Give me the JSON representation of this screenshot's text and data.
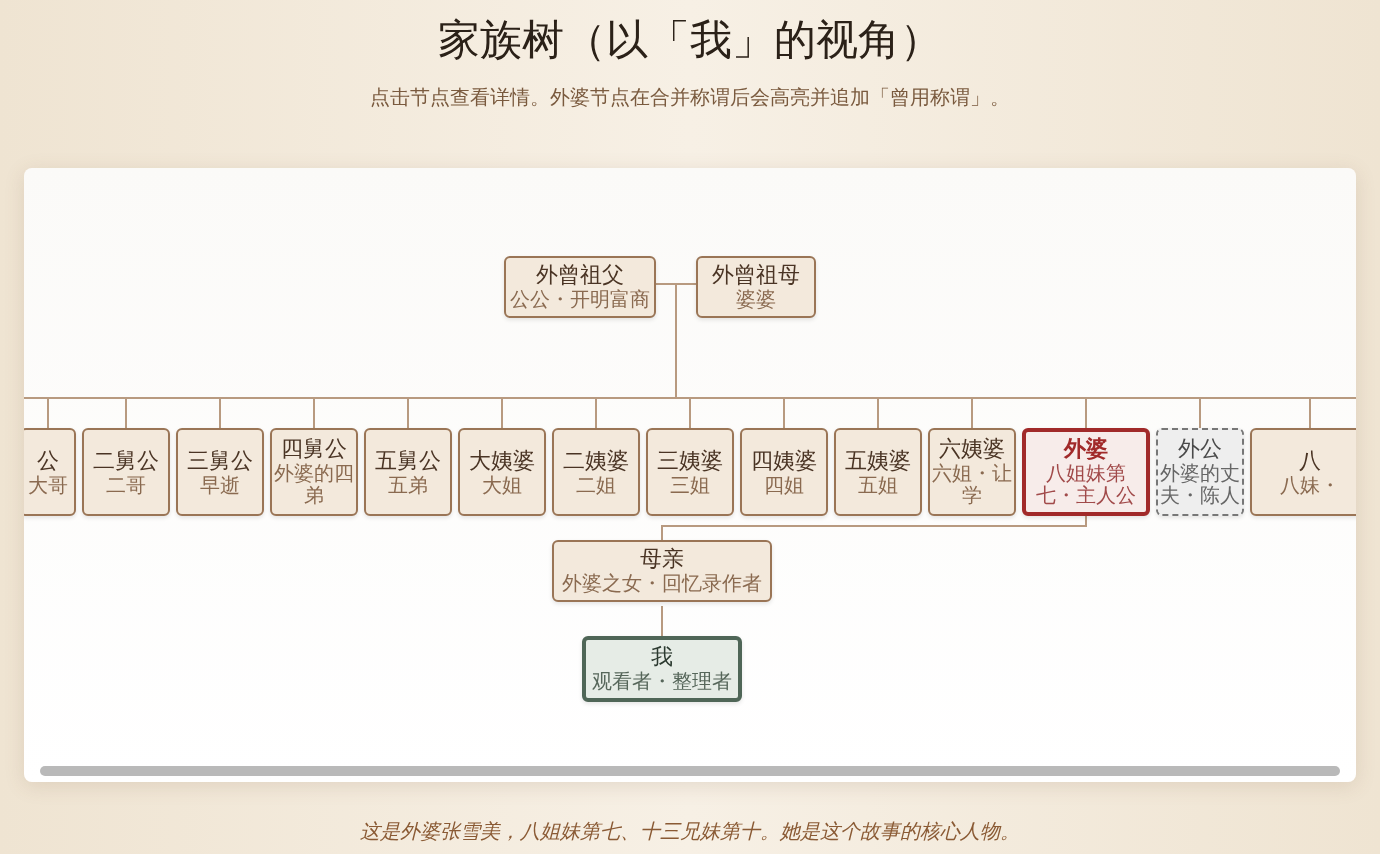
{
  "title": "家族树（以「我」的视角）",
  "subtitle": "点击节点查看详情。外婆节点在合并称谓后会高亮并追加「曾用称谓」。",
  "tree": {
    "ancestors": [
      {
        "name": "外曾祖父",
        "note": "公公・开明富商",
        "kind": "normal"
      },
      {
        "name": "外曾祖母",
        "note": "婆婆",
        "kind": "normal"
      }
    ],
    "generation": [
      {
        "name": "公",
        "note": "大哥",
        "kind": "normal"
      },
      {
        "name": "二舅公",
        "note": "二哥",
        "kind": "normal"
      },
      {
        "name": "三舅公",
        "note": "早逝",
        "kind": "normal"
      },
      {
        "name": "四舅公",
        "note": "外婆的四弟",
        "kind": "normal"
      },
      {
        "name": "五舅公",
        "note": "五弟",
        "kind": "normal"
      },
      {
        "name": "大姨婆",
        "note": "大姐",
        "kind": "normal"
      },
      {
        "name": "二姨婆",
        "note": "二姐",
        "kind": "normal"
      },
      {
        "name": "三姨婆",
        "note": "三姐",
        "kind": "normal"
      },
      {
        "name": "四姨婆",
        "note": "四姐",
        "kind": "normal"
      },
      {
        "name": "五姨婆",
        "note": "五姐",
        "kind": "normal"
      },
      {
        "name": "六姨婆",
        "note": "六姐・让学",
        "kind": "normal"
      },
      {
        "name": "外婆",
        "note": "八姐妹第七・主人公",
        "kind": "highlight"
      },
      {
        "name": "外公",
        "note": "外婆的丈夫・陈人",
        "kind": "spouse"
      },
      {
        "name": "八",
        "note": "八妹・",
        "kind": "normal"
      }
    ],
    "mother": {
      "name": "母亲",
      "note": "外婆之女・回忆录作者",
      "kind": "normal"
    },
    "self": {
      "name": "我",
      "note": "观看者・整理者",
      "kind": "self"
    }
  },
  "caption": "这是外婆张雪美，八姐妹第七、十三兄妹第十。她是这个故事的核心人物。"
}
